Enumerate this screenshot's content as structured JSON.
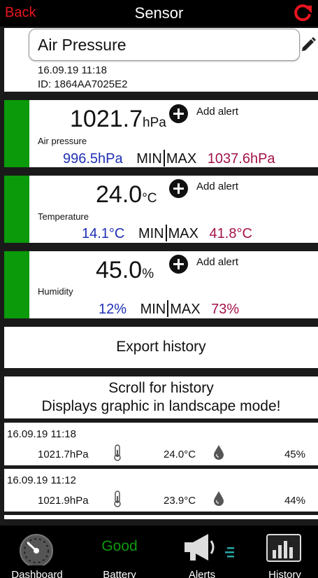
{
  "header": {
    "back_label": "Back",
    "title": "Sensor"
  },
  "sensor": {
    "name": "Air Pressure",
    "date": "16.09.19  11:18",
    "id": "ID: 1864AA7025E2"
  },
  "pressure": {
    "value": "1021.7",
    "unit": "hPa",
    "add_alert": "Add alert",
    "label": "Air pressure",
    "min": "996.5hPa",
    "min_label": "MIN",
    "max_label": "MAX",
    "max": "1037.6hPa"
  },
  "temperature": {
    "value": "24.0",
    "unit": "°C",
    "add_alert": "Add alert",
    "label": "Temperature",
    "min": "14.1°C",
    "min_label": "MIN",
    "max_label": "MAX",
    "max": "41.8°C"
  },
  "humidity": {
    "value": "45.0",
    "unit": "%",
    "add_alert": "Add alert",
    "label": "Humidity",
    "min": "12%",
    "min_label": "MIN",
    "max_label": "MAX",
    "max": "73%"
  },
  "export_label": "Export history",
  "scroll_info": {
    "line1": "Scroll for history",
    "line2": "Displays graphic in landscape mode!"
  },
  "history": [
    {
      "date": "16.09.19  11:18",
      "pressure": "1021.7hPa",
      "temp": "24.0°C",
      "humidity": "45%"
    },
    {
      "date": "16.09.19  11:12",
      "pressure": "1021.9hPa",
      "temp": "23.9°C",
      "humidity": "44%"
    }
  ],
  "nav": {
    "dashboard": "Dashboard",
    "battery_status": "Good",
    "battery": "Battery",
    "alerts": "Alerts",
    "history": "History"
  },
  "colors": {
    "accent_red": "#e8141e",
    "status_green": "#0a9a0a",
    "min_blue": "#1e2fb5",
    "max_red": "#a3124a"
  },
  "icons": [
    "refresh-icon",
    "pencil-icon",
    "plus-icon",
    "thermometer-icon",
    "drop-icon",
    "gauge-icon",
    "megaphone-icon",
    "chart-icon"
  ]
}
